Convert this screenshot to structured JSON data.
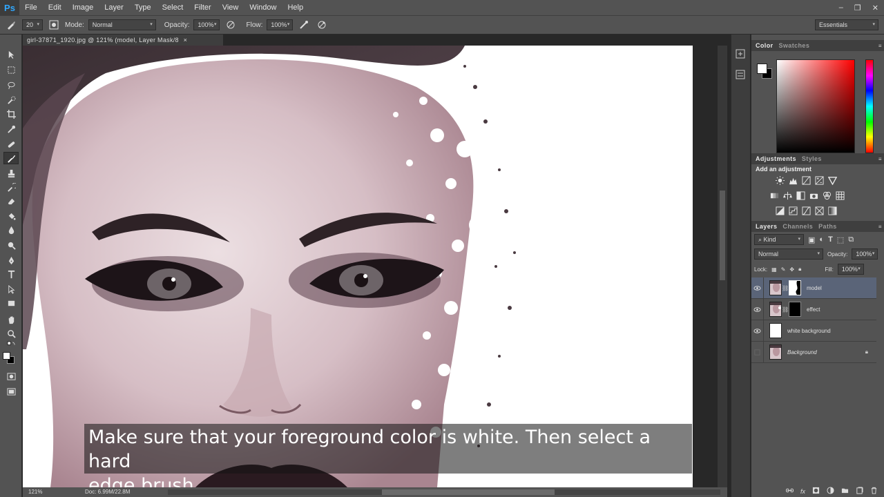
{
  "app": {
    "logo": "Ps"
  },
  "menu": [
    "File",
    "Edit",
    "Image",
    "Layer",
    "Type",
    "Select",
    "Filter",
    "View",
    "Window",
    "Help"
  ],
  "window_controls": [
    "–",
    "❐",
    "✕"
  ],
  "options_bar": {
    "brush_size": "20",
    "mode_label": "Mode:",
    "mode_value": "Normal",
    "opacity_label": "Opacity:",
    "opacity_value": "100%",
    "flow_label": "Flow:",
    "flow_value": "100%",
    "workspace": "Essentials"
  },
  "document": {
    "tab_title": "girl-37871_1920.jpg @ 121% (model, Layer Mask/8",
    "zoom": "121%",
    "doc_size": "Doc: 6.99M/22.8M"
  },
  "caption": {
    "line1": "Make sure that your foreground color is white. Then select a hard",
    "line2": "edge brush."
  },
  "color_panel": {
    "tab_active": "Color",
    "tab_inactive": "Swatches",
    "foreground": "#ffffff",
    "background": "#000000"
  },
  "adjustments_panel": {
    "tab_active": "Adjustments",
    "tab_inactive": "Styles",
    "title": "Add an adjustment"
  },
  "layers_panel": {
    "tabs": [
      "Layers",
      "Channels",
      "Paths"
    ],
    "kind_label": "Kind",
    "blend_mode": "Normal",
    "opacity_label": "Opacity:",
    "opacity_value": "100%",
    "lock_label": "Lock:",
    "fill_label": "Fill:",
    "fill_value": "100%",
    "layers": [
      {
        "name": "model",
        "selected": true,
        "visible": true
      },
      {
        "name": "effect",
        "selected": false,
        "visible": true
      },
      {
        "name": "white background",
        "selected": false,
        "visible": true
      },
      {
        "name": "Background",
        "selected": false,
        "visible": false,
        "locked": true
      }
    ]
  },
  "colors": {
    "accent": "#31a8ff",
    "panel": "#535353",
    "selected_layer": "#5a6478"
  }
}
